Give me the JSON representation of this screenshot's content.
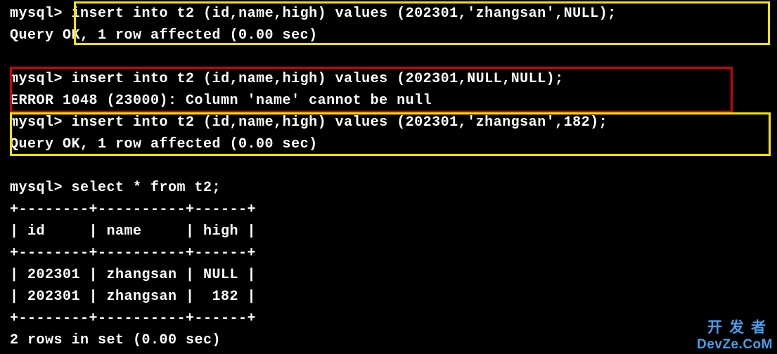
{
  "terminal": {
    "prompt": "mysql>",
    "block1": {
      "cmd": "insert into t2 (id,name,high) values (202301,'zhangsan',NULL);",
      "result": "Query OK, 1 row affected (0.00 sec)"
    },
    "block2": {
      "cmd": "insert into t2 (id,name,high) values (202301,NULL,NULL);",
      "result": "ERROR 1048 (23000): Column 'name' cannot be null"
    },
    "block3": {
      "cmd": "insert into t2 (id,name,high) values (202301,'zhangsan',182);",
      "result": "Query OK, 1 row affected (0.00 sec)"
    },
    "block4": {
      "cmd": "select * from t2;",
      "table": {
        "border": "+--------+----------+------+",
        "header": "| id     | name     | high |",
        "rows": [
          "| 202301 | zhangsan | NULL |",
          "| 202301 | zhangsan |  182 |"
        ]
      },
      "summary": "2 rows in set (0.00 sec)"
    }
  },
  "watermark": {
    "cn": "开发者",
    "en": "DevZe.CoM"
  },
  "chart_data": {
    "type": "table",
    "title": "t2",
    "columns": [
      "id",
      "name",
      "high"
    ],
    "rows": [
      [
        202301,
        "zhangsan",
        null
      ],
      [
        202301,
        "zhangsan",
        182
      ]
    ]
  }
}
